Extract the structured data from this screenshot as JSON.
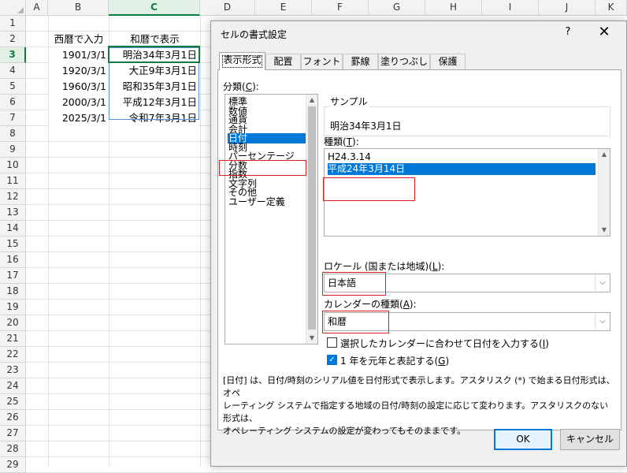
{
  "sheet": {
    "columns": [
      "A",
      "B",
      "C",
      "D",
      "E",
      "F",
      "G",
      "H",
      "I",
      "J",
      "K"
    ],
    "rows": [
      "1",
      "2",
      "3",
      "4",
      "5",
      "6",
      "7",
      "8",
      "9",
      "10",
      "11",
      "12",
      "13",
      "14",
      "15",
      "16",
      "17",
      "18",
      "19",
      "20",
      "21",
      "22",
      "23",
      "24",
      "25",
      "26",
      "27",
      "28",
      "29"
    ],
    "header_b": "西暦で入力",
    "header_c": "和暦で表示",
    "data": [
      {
        "b": "1901/3/1",
        "c": "明治34年3月1日"
      },
      {
        "b": "1920/3/1",
        "c": "大正9年3月1日"
      },
      {
        "b": "1960/3/1",
        "c": "昭和35年3月1日"
      },
      {
        "b": "2000/3/1",
        "c": "平成12年3月1日"
      },
      {
        "b": "2025/3/1",
        "c": "令和7年3月1日"
      }
    ]
  },
  "dialog": {
    "title": "セルの書式設定",
    "help": "?",
    "close": "✕",
    "tabs": [
      "表示形式",
      "配置",
      "フォント",
      "罫線",
      "塗りつぶし",
      "保護"
    ],
    "category_label": "分類(C):",
    "categories": [
      "標準",
      "数値",
      "通貨",
      "会計",
      "日付",
      "時刻",
      "パーセンテージ",
      "分数",
      "指数",
      "文字列",
      "その他",
      "ユーザー定義"
    ],
    "selected_category": "日付",
    "sample_label": "サンプル",
    "sample_value": "明治34年3月1日",
    "type_label": "種類(T):",
    "types": [
      "H24.3.14",
      "平成24年3月14日"
    ],
    "selected_type": "平成24年3月14日",
    "locale_label": "ロケール (国または地域)(L):",
    "locale_value": "日本語",
    "calendar_label": "カレンダーの種類(A):",
    "calendar_value": "和暦",
    "check1_label": "選択したカレンダーに合わせて日付を入力する(I)",
    "check1_on": false,
    "check2_label": "1 年を元年と表記する(G)",
    "check2_on": true,
    "description_line1": "[日付] は、日付/時刻のシリアル値を日付形式で表示します。アスタリスク (*) で始まる日付形式は、オペ",
    "description_line2": "レーティング システムで指定する地域の日付/時刻の設定に応じて変わります。アスタリスクのない形式は、",
    "description_line3": "オペレーティング システムの設定が変わってもそのままです。",
    "ok": "OK",
    "cancel": "キャンセル"
  },
  "colors": {
    "accent": "#0078d7",
    "excel_green": "#107c41",
    "highlight_red": "#e02020"
  }
}
